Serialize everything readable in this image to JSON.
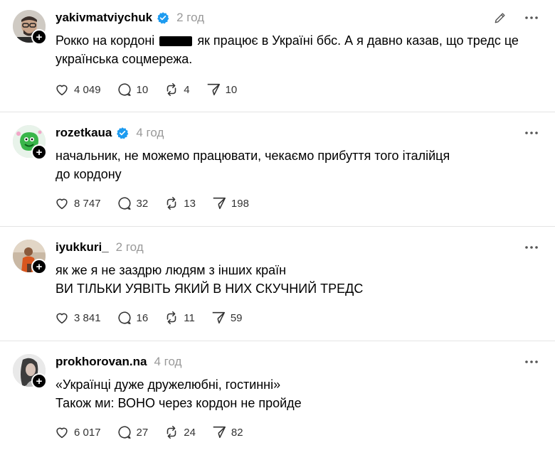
{
  "posts": [
    {
      "username": "yakivmatviychuk",
      "verified": true,
      "time": "2 год",
      "text_before": "Рокко на кордоні",
      "text_after": "як працює в Україні ббс. А я давно казав, що тредс це українська соцмережа.",
      "likes": "4 049",
      "comments": "10",
      "reposts": "4",
      "shares": "10"
    },
    {
      "username": "rozetkaua",
      "verified": true,
      "time": "4 год",
      "lines": [
        "начальник, не можемо працювати, чекаємо прибуття того італійця",
        "до кордону"
      ],
      "likes": "8 747",
      "comments": "32",
      "reposts": "13",
      "shares": "198"
    },
    {
      "username": "iyukkuri_",
      "verified": false,
      "time": "2 год",
      "lines": [
        "як же я не заздрю людям з інших країн",
        "ВИ ТІЛЬКИ УЯВІТЬ ЯКИЙ В НИХ СКУЧНИЙ ТРЕДС"
      ],
      "likes": "3 841",
      "comments": "16",
      "reposts": "11",
      "shares": "59"
    },
    {
      "username": "prokhorovan.na",
      "verified": false,
      "time": "4 год",
      "lines": [
        "«Українці дуже дружелюбні, гостинні»",
        "Також ми: ВОНО через кордон не пройде"
      ],
      "likes": "6 017",
      "comments": "27",
      "reposts": "24",
      "shares": "82"
    }
  ],
  "icons": {
    "edit": "pencil-icon",
    "more": "more-horizontal-icon",
    "like": "heart-icon",
    "comment": "comment-bubble-icon",
    "repost": "repost-arrows-icon",
    "share": "send-paper-plane-icon",
    "verified": "verified-badge-icon",
    "follow": "plus-icon"
  },
  "colors": {
    "verified": "#1d9bf0",
    "muted": "#999999",
    "divider": "#e4e4e4",
    "text": "#000000"
  }
}
